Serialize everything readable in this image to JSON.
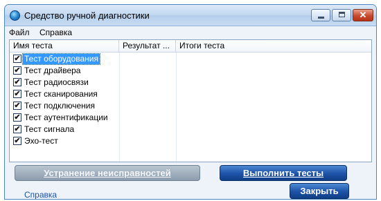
{
  "window": {
    "title": "Средство ручной диагностики"
  },
  "menu": {
    "items": [
      "Файл",
      "Справка"
    ]
  },
  "table": {
    "columns": [
      "Имя теста",
      "Результат ...",
      "Итоги теста"
    ],
    "rows": [
      {
        "label": "Тест оборудования",
        "checked": true,
        "selected": true
      },
      {
        "label": "Тест драйвера",
        "checked": true,
        "selected": false
      },
      {
        "label": "Тест радиосвязи",
        "checked": true,
        "selected": false
      },
      {
        "label": "Тест сканирования",
        "checked": true,
        "selected": false
      },
      {
        "label": "Тест подключения",
        "checked": true,
        "selected": false
      },
      {
        "label": "Тест аутентификации",
        "checked": true,
        "selected": false
      },
      {
        "label": "Тест сигнала",
        "checked": true,
        "selected": false
      },
      {
        "label": "Эхо-тест",
        "checked": true,
        "selected": false
      }
    ]
  },
  "buttons": {
    "troubleshoot": "Устранение неисправностей",
    "run_tests": "Выполнить тесты",
    "close": "Закрыть"
  },
  "footer": {
    "help_link": "Справка"
  },
  "colors": {
    "accent": "#1c52a6",
    "selection": "#3399ff",
    "disabled_button": "#9aa9b8"
  },
  "icons": {
    "app": "diagnostics-app-icon",
    "check": "✔"
  }
}
